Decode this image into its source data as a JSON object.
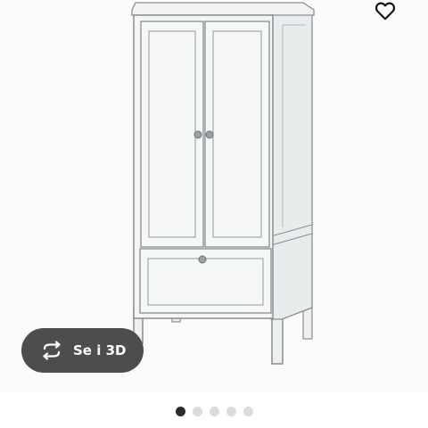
{
  "product_image": {
    "alt": ""
  },
  "favorite": {
    "icon": "heart-outline-icon"
  },
  "view3d": {
    "label": "Se i 3D",
    "icon": "rotate-3d-icon"
  },
  "carousel": {
    "count": 5,
    "active_index": 0
  },
  "colors": {
    "pill_bg": "#4d4d4d",
    "dot_active": "#2b2b2b",
    "dot_inactive": "#dcdcdc",
    "furniture": "#f4f5f5",
    "outline": "#7d8285"
  }
}
